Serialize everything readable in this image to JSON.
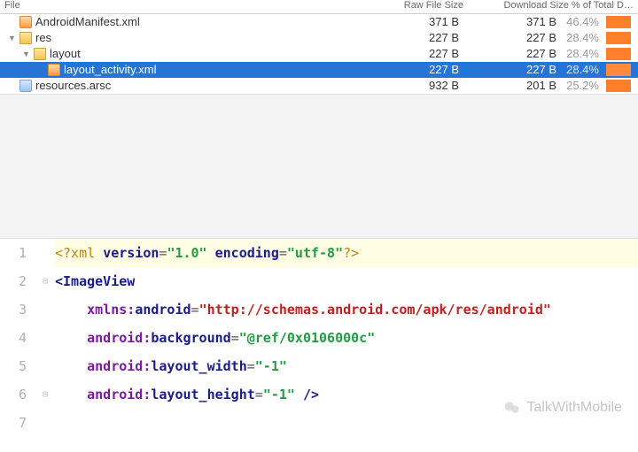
{
  "header": {
    "col_file": "File",
    "col_raw": "Raw File Size",
    "col_dl": "Download Size % of Total D…"
  },
  "tree": [
    {
      "name": "AndroidManifest.xml",
      "icon": "xml",
      "indent": 0,
      "disclose": "none",
      "raw": "371 B",
      "dl": "371 B",
      "pct": "46.4%",
      "selected": false
    },
    {
      "name": "res",
      "icon": "folder",
      "indent": 0,
      "disclose": "open",
      "raw": "227 B",
      "dl": "227 B",
      "pct": "28.4%",
      "selected": false
    },
    {
      "name": "layout",
      "icon": "folder",
      "indent": 1,
      "disclose": "open",
      "raw": "227 B",
      "dl": "227 B",
      "pct": "28.4%",
      "selected": false
    },
    {
      "name": "layout_activity.xml",
      "icon": "xml",
      "indent": 2,
      "disclose": "none",
      "raw": "227 B",
      "dl": "227 B",
      "pct": "28.4%",
      "selected": true
    },
    {
      "name": "resources.arsc",
      "icon": "arsc",
      "indent": 0,
      "disclose": "none",
      "raw": "932 B",
      "dl": "201 B",
      "pct": "25.2%",
      "selected": false
    }
  ],
  "code": {
    "lines": [
      {
        "n": "1",
        "fold": "",
        "hl": true,
        "tokens": [
          [
            "proc",
            "<?xml "
          ],
          [
            "attr",
            "version"
          ],
          [
            "sym",
            "="
          ],
          [
            "str",
            "\"1.0\""
          ],
          [
            "proc",
            " "
          ],
          [
            "attr",
            "encoding"
          ],
          [
            "sym",
            "="
          ],
          [
            "str",
            "\"utf-8\""
          ],
          [
            "proc",
            "?>"
          ]
        ]
      },
      {
        "n": "2",
        "fold": "⊟",
        "hl": false,
        "tokens": [
          [
            "tag",
            "<ImageView"
          ]
        ]
      },
      {
        "n": "3",
        "fold": "",
        "hl": false,
        "tokens": [
          [
            "",
            "    "
          ],
          [
            "ns",
            "xmlns:"
          ],
          [
            "attr",
            "android"
          ],
          [
            "sym",
            "="
          ],
          [
            "url",
            "\"http://schemas.android.com/apk/res/android\""
          ]
        ]
      },
      {
        "n": "4",
        "fold": "",
        "hl": false,
        "tokens": [
          [
            "",
            "    "
          ],
          [
            "ns",
            "android:"
          ],
          [
            "attr",
            "background"
          ],
          [
            "sym",
            "="
          ],
          [
            "str",
            "\"@ref/0x0106000c\""
          ]
        ]
      },
      {
        "n": "5",
        "fold": "",
        "hl": false,
        "tokens": [
          [
            "",
            "    "
          ],
          [
            "ns",
            "android:"
          ],
          [
            "attr",
            "layout_width"
          ],
          [
            "sym",
            "="
          ],
          [
            "str",
            "\"-1\""
          ]
        ]
      },
      {
        "n": "6",
        "fold": "⊟",
        "hl": false,
        "tokens": [
          [
            "",
            "    "
          ],
          [
            "ns",
            "android:"
          ],
          [
            "attr",
            "layout_height"
          ],
          [
            "sym",
            "="
          ],
          [
            "str",
            "\"-1\""
          ],
          [
            "tag",
            " />"
          ]
        ]
      },
      {
        "n": "7",
        "fold": "",
        "hl": false,
        "tokens": [
          [
            "",
            ""
          ]
        ]
      }
    ]
  },
  "watermark": "TalkWithMobile"
}
